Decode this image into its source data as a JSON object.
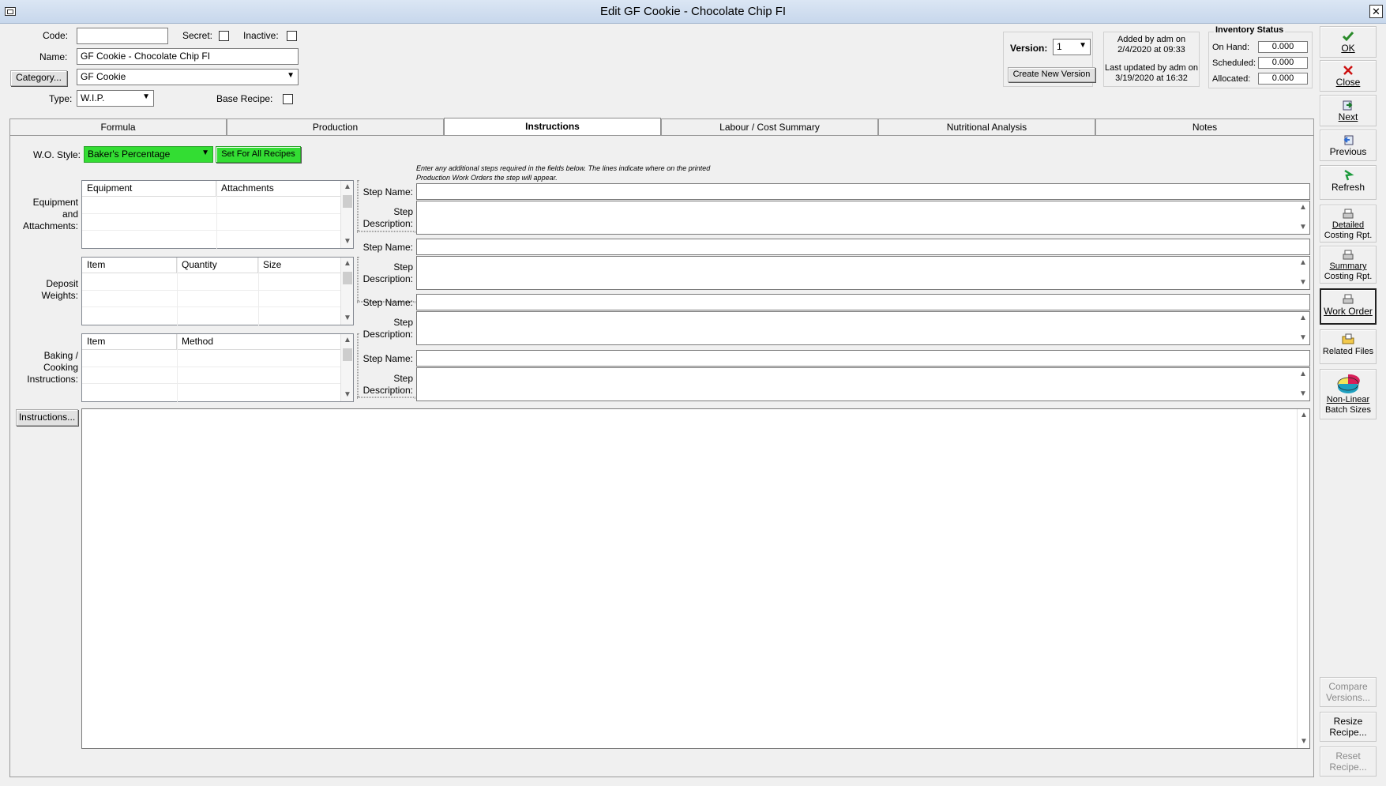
{
  "window": {
    "title": "Edit GF Cookie - Chocolate Chip FI"
  },
  "header": {
    "code_label": "Code:",
    "code_value": "",
    "secret_label": "Secret:",
    "inactive_label": "Inactive:",
    "name_label": "Name:",
    "name_value": "GF Cookie - Chocolate Chip FI",
    "category_button": "Category...",
    "category_value": "GF Cookie",
    "type_label": "Type:",
    "type_value": "W.I.P.",
    "base_recipe_label": "Base Recipe:"
  },
  "version": {
    "label": "Version:",
    "value": "1",
    "create_button": "Create New Version",
    "added_line1": "Added by adm on",
    "added_line2": "2/4/2020 at 09:33",
    "updated_line1": "Last updated by adm on",
    "updated_line2": "3/19/2020 at 16:32"
  },
  "inventory": {
    "title": "Inventory Status",
    "on_hand_label": "On Hand:",
    "on_hand": "0.000",
    "scheduled_label": "Scheduled:",
    "scheduled": "0.000",
    "allocated_label": "Allocated:",
    "allocated": "0.000"
  },
  "tabs": [
    "Formula",
    "Production",
    "Instructions",
    "Labour / Cost Summary",
    "Nutritional Analysis",
    "Notes"
  ],
  "instructions": {
    "wo_style_label": "W.O. Style:",
    "wo_style_value": "Baker's Percentage",
    "set_all_button": "Set For All Recipes",
    "hint_line1": "Enter any additional steps required in the fields below.  The lines indicate where on the printed",
    "hint_line2": "Production Work Orders the step will appear.",
    "equipment_label": [
      "Equipment",
      "and",
      "Attachments:"
    ],
    "equipment_cols": [
      "Equipment",
      "Attachments"
    ],
    "deposit_label": [
      "Deposit",
      "Weights:"
    ],
    "deposit_cols": [
      "Item",
      "Quantity",
      "Size"
    ],
    "baking_label": [
      "Baking /",
      "Cooking",
      "Instructions:"
    ],
    "baking_cols": [
      "Item",
      "Method"
    ],
    "step_name_label": "Step Name:",
    "step_desc_label": [
      "Step",
      "Description:"
    ],
    "instructions_button": "Instructions..."
  },
  "toolbar": {
    "ok": "OK",
    "close": "Close",
    "next": "Next",
    "previous": "Previous",
    "refresh": "Refresh",
    "detailed": [
      "Detailed",
      "Costing Rpt."
    ],
    "summary": [
      "Summary",
      "Costing Rpt."
    ],
    "work_order": "Work Order",
    "related_files": "Related Files",
    "non_linear": [
      "Non-Linear",
      "Batch Sizes"
    ],
    "compare": [
      "Compare",
      "Versions..."
    ],
    "resize": [
      "Resize",
      "Recipe..."
    ],
    "reset": [
      "Reset",
      "Recipe..."
    ]
  },
  "colors": {
    "green": "#33dd33",
    "ok_check": "#2a8a2a",
    "close_x": "#cc1111"
  }
}
